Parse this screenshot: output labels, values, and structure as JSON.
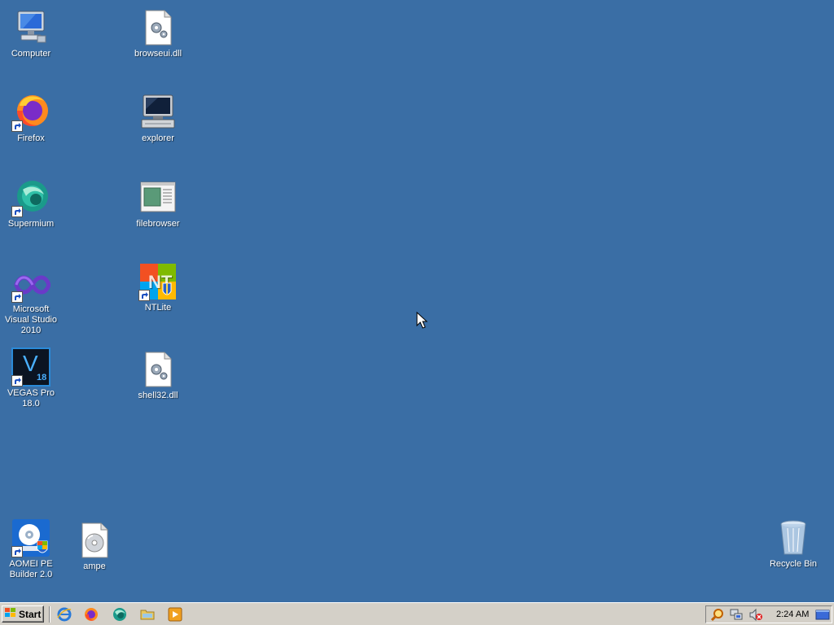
{
  "desktop": {
    "background_color": "#3a6ea5",
    "icons": {
      "computer": {
        "label": "Computer",
        "icon": "computer-icon"
      },
      "browseui": {
        "label": "browseui.dll",
        "icon": "dll-file-icon"
      },
      "firefox": {
        "label": "Firefox",
        "icon": "firefox-icon"
      },
      "explorer": {
        "label": "explorer",
        "icon": "explorer-icon"
      },
      "supermium": {
        "label": "Supermium",
        "icon": "supermium-icon"
      },
      "filebrowser": {
        "label": "filebrowser",
        "icon": "filebrowser-icon"
      },
      "msvs": {
        "label": "Microsoft Visual Studio 2010",
        "icon": "visual-studio-icon"
      },
      "ntlite": {
        "label": "NTLite",
        "icon": "ntlite-icon"
      },
      "vegas": {
        "label": "VEGAS Pro 18.0",
        "icon": "vegas-pro-icon",
        "glyph": "V",
        "badge": "18"
      },
      "shell32": {
        "label": "shell32.dll",
        "icon": "dll-file-icon"
      },
      "aomei": {
        "label": "AOMEI PE Builder 2.0",
        "icon": "aomei-icon"
      },
      "ampe": {
        "label": "ampe",
        "icon": "disc-image-icon"
      },
      "recycle": {
        "label": "Recycle Bin",
        "icon": "recycle-bin-icon"
      }
    }
  },
  "taskbar": {
    "start_label": "Start",
    "quick_launch": [
      "internet-explorer-icon",
      "firefox-icon",
      "supermium-icon",
      "folder-icon",
      "media-player-icon"
    ],
    "tray_icons": [
      "search-icon",
      "network-icon",
      "volume-muted-icon",
      "show-desktop-icon"
    ],
    "clock": "2:24 AM"
  }
}
